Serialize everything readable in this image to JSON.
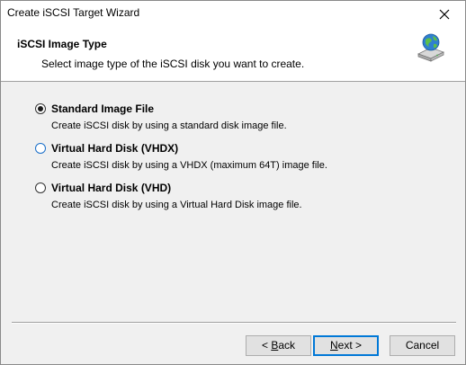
{
  "window": {
    "title": "Create iSCSI Target Wizard"
  },
  "header": {
    "title": "iSCSI Image Type",
    "subtitle": "Select image type of the iSCSI disk you want to create.",
    "icon": "network-disk-icon"
  },
  "options": [
    {
      "label": "Standard Image File",
      "description": "Create iSCSI disk by using a standard disk image file.",
      "selected": true
    },
    {
      "label": "Virtual Hard Disk (VHDX)",
      "description": "Create iSCSI disk by using a VHDX (maximum 64T) image file.",
      "selected": false
    },
    {
      "label": "Virtual Hard Disk (VHD)",
      "description": "Create iSCSI disk by using a Virtual Hard Disk image file.",
      "selected": false
    }
  ],
  "buttons": {
    "back": {
      "prefix": "< ",
      "mnemonic": "B",
      "rest": "ack"
    },
    "next": {
      "mnemonic": "N",
      "rest": "ext >"
    },
    "cancel": "Cancel"
  },
  "colors": {
    "accent": "#0078d7",
    "header_bg": "#ffffff",
    "body_bg": "#f0f0f0"
  }
}
